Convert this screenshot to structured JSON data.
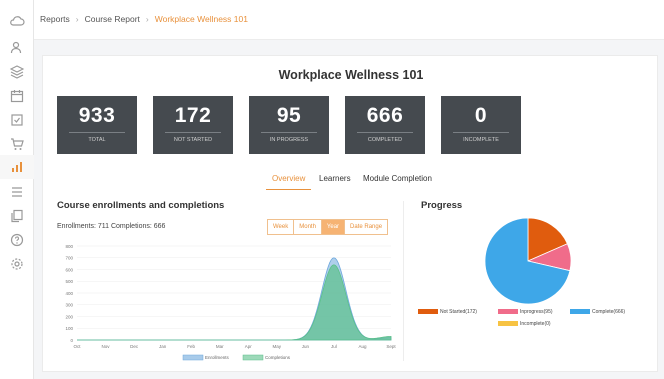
{
  "breadcrumb": [
    "Reports",
    "Course Report",
    "Workplace Wellness 101"
  ],
  "course_title": "Workplace Wellness 101",
  "stats": [
    {
      "value": "933",
      "label": "TOTAL"
    },
    {
      "value": "172",
      "label": "NOT STARTED"
    },
    {
      "value": "95",
      "label": "IN PROGRESS"
    },
    {
      "value": "666",
      "label": "COMPLETED"
    },
    {
      "value": "0",
      "label": "INCOMPLETE"
    }
  ],
  "tabs": [
    "Overview",
    "Learners",
    "Module Completion"
  ],
  "active_tab": "Overview",
  "enrollments_section": {
    "title": "Course enrollments and completions",
    "summary": "Enrollments: 711 Completions: 666",
    "range_buttons": [
      "Week",
      "Month",
      "Year",
      "Date Range"
    ],
    "active_range": "Year"
  },
  "progress_section": {
    "title": "Progress"
  },
  "colors": {
    "accent": "#e8913c",
    "stat_box": "#454a4f",
    "enrollments": "#6ea8dc",
    "completions": "#5bc08a",
    "not_started": "#e05c0e",
    "inprogress": "#f06c8a",
    "complete": "#3ea7e8",
    "incomplete": "#f7c343"
  },
  "chart_data": [
    {
      "type": "area",
      "categories": [
        "Oct",
        "Nov",
        "Dec",
        "Jan",
        "Feb",
        "Mar",
        "Apr",
        "May",
        "Jun",
        "Jul",
        "Aug",
        "Sept"
      ],
      "ylim": [
        0,
        800
      ],
      "yticks": [
        "800",
        "700",
        "600",
        "500",
        "400",
        "300",
        "200",
        "100",
        "0"
      ],
      "series": [
        {
          "name": "Enrollments",
          "values": [
            0,
            0,
            0,
            0,
            0,
            0,
            0,
            0,
            0,
            700,
            0,
            20
          ]
        },
        {
          "name": "Completions",
          "values": [
            0,
            0,
            0,
            0,
            0,
            0,
            0,
            0,
            0,
            640,
            0,
            30
          ]
        }
      ],
      "legend": "bottom"
    },
    {
      "type": "pie",
      "slices": [
        {
          "name": "Not Started(172)",
          "value": 172
        },
        {
          "name": "Inprogress(95)",
          "value": 95
        },
        {
          "name": "Complete(666)",
          "value": 666
        },
        {
          "name": "Incomplete(0)",
          "value": 0
        }
      ],
      "legend": "bottom"
    }
  ]
}
